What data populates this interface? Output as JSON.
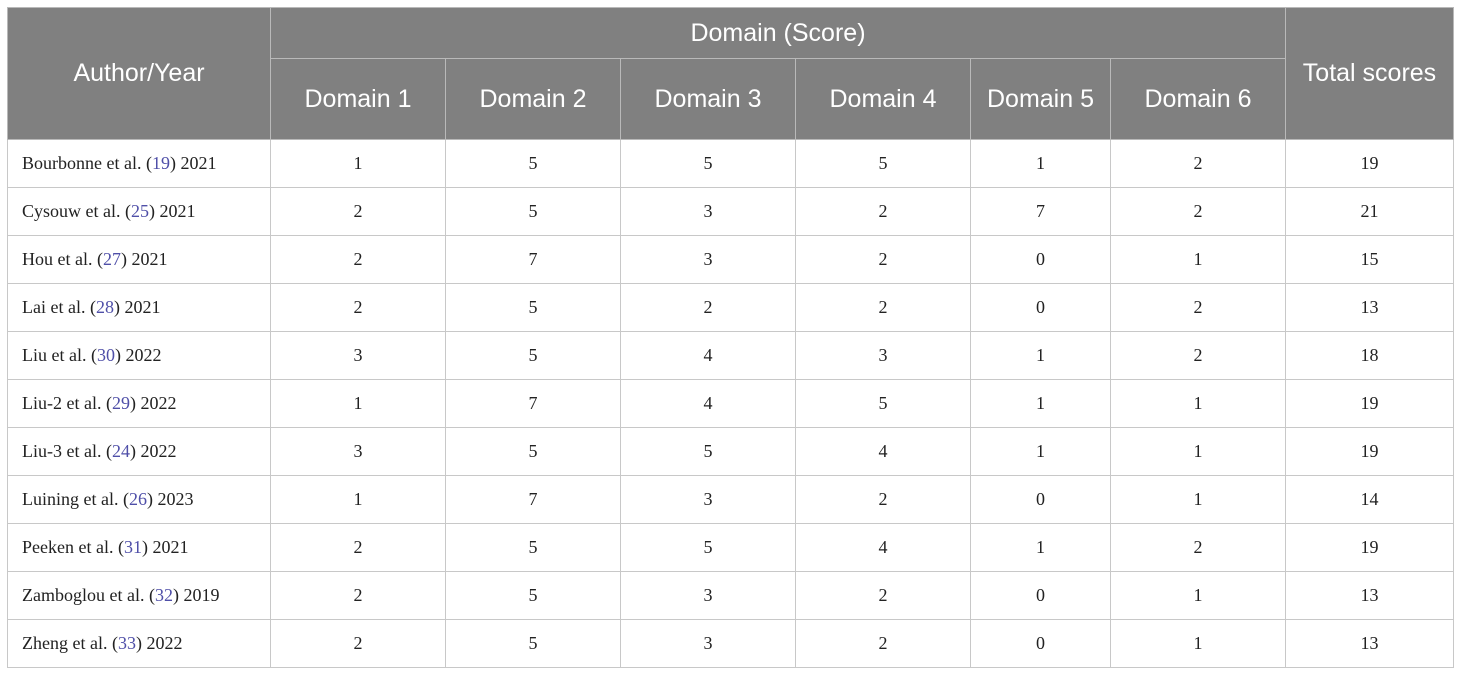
{
  "table": {
    "header": {
      "author_label": "Author/Year",
      "group_label": "Domain (Score)",
      "total_label": "Total scores",
      "domains": [
        "Domain 1",
        "Domain 2",
        "Domain 3",
        "Domain 4",
        "Domain 5",
        "Domain 6"
      ]
    },
    "rows": [
      {
        "author": "Bourbonne et al.",
        "ref": "19",
        "year": "2021",
        "scores": [
          "1",
          "5",
          "5",
          "5",
          "1",
          "2"
        ],
        "total": "19"
      },
      {
        "author": "Cysouw et al.",
        "ref": "25",
        "year": "2021",
        "scores": [
          "2",
          "5",
          "3",
          "2",
          "7",
          "2"
        ],
        "total": "21"
      },
      {
        "author": "Hou et al.",
        "ref": "27",
        "year": "2021",
        "scores": [
          "2",
          "7",
          "3",
          "2",
          "0",
          "1"
        ],
        "total": "15"
      },
      {
        "author": "Lai et al.",
        "ref": "28",
        "year": "2021",
        "scores": [
          "2",
          "5",
          "2",
          "2",
          "0",
          "2"
        ],
        "total": "13"
      },
      {
        "author": "Liu et al.",
        "ref": "30",
        "year": "2022",
        "scores": [
          "3",
          "5",
          "4",
          "3",
          "1",
          "2"
        ],
        "total": "18"
      },
      {
        "author": "Liu-2 et al.",
        "ref": "29",
        "year": "2022",
        "scores": [
          "1",
          "7",
          "4",
          "5",
          "1",
          "1"
        ],
        "total": "19"
      },
      {
        "author": "Liu-3 et al.",
        "ref": "24",
        "year": "2022",
        "scores": [
          "3",
          "5",
          "5",
          "4",
          "1",
          "1"
        ],
        "total": "19"
      },
      {
        "author": "Luining et al.",
        "ref": "26",
        "year": "2023",
        "scores": [
          "1",
          "7",
          "3",
          "2",
          "0",
          "1"
        ],
        "total": "14"
      },
      {
        "author": "Peeken et al.",
        "ref": "31",
        "year": "2021",
        "scores": [
          "2",
          "5",
          "5",
          "4",
          "1",
          "2"
        ],
        "total": "19"
      },
      {
        "author": "Zamboglou et al.",
        "ref": "32",
        "year": "2019",
        "scores": [
          "2",
          "5",
          "3",
          "2",
          "0",
          "1"
        ],
        "total": "13"
      },
      {
        "author": "Zheng et al.",
        "ref": "33",
        "year": "2022",
        "scores": [
          "2",
          "5",
          "3",
          "2",
          "0",
          "1"
        ],
        "total": "13"
      }
    ]
  }
}
